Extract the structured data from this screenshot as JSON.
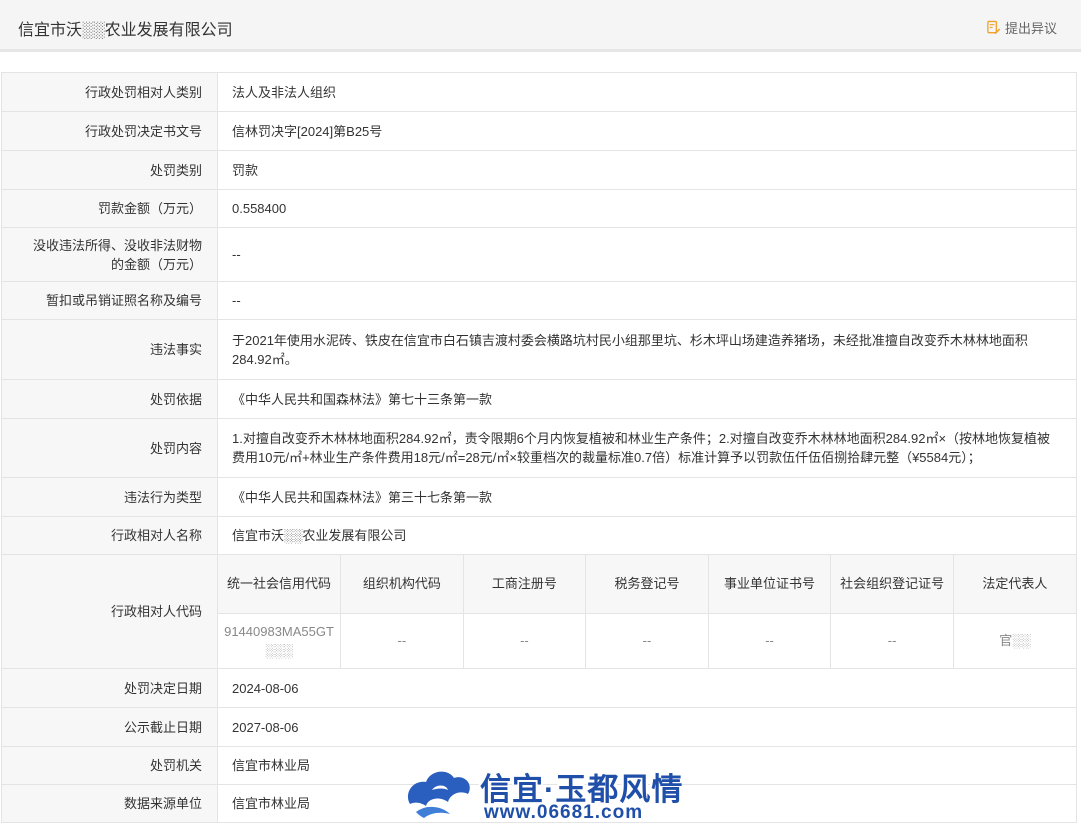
{
  "header": {
    "company_title": "信宜市沃░░农业发展有限公司",
    "objection_label": "提出异议",
    "objection_icon": "edit-document-icon",
    "accent_color": "#f0a22e"
  },
  "rows": {
    "party_type": {
      "label": "行政处罚相对人类别",
      "value": "法人及非法人组织"
    },
    "decision_no": {
      "label": "行政处罚决定书文号",
      "value": "信林罚决字[2024]第B25号"
    },
    "penalty_type": {
      "label": "处罚类别",
      "value": "罚款"
    },
    "fine_amount": {
      "label": "罚款金额（万元）",
      "value": "0.558400"
    },
    "confiscated": {
      "label": "没收违法所得、没收非法财物的金额（万元）",
      "value": "--"
    },
    "license": {
      "label": "暂扣或吊销证照名称及编号",
      "value": "--"
    },
    "facts": {
      "label": "违法事实",
      "value": "于2021年使用水泥砖、铁皮在信宜市白石镇吉渡村委会横路坑村民小组那里坑、杉木坪山场建造养猪场，未经批准擅自改变乔木林林地面积284.92㎡。"
    },
    "basis": {
      "label": "处罚依据",
      "value": "《中华人民共和国森林法》第七十三条第一款"
    },
    "content": {
      "label": "处罚内容",
      "value": "1.对擅自改变乔木林林地面积284.92㎡，责令限期6个月内恢复植被和林业生产条件；2.对擅自改变乔木林林地面积284.92㎡×（按林地恢复植被费用10元/㎡+林业生产条件费用18元/㎡=28元/㎡×较重档次的裁量标准0.7倍）标准计算予以罚款伍仟伍佰捌拾肆元整（¥5584元）；"
    },
    "violation_type": {
      "label": "违法行为类型",
      "value": "《中华人民共和国森林法》第三十七条第一款"
    },
    "party_name": {
      "label": "行政相对人名称",
      "value": "信宜市沃░░农业发展有限公司"
    },
    "party_code": {
      "label": "行政相对人代码"
    },
    "decision_date": {
      "label": "处罚决定日期",
      "value": "2024-08-06"
    },
    "publish_end": {
      "label": "公示截止日期",
      "value": "2027-08-06"
    },
    "authority": {
      "label": "处罚机关",
      "value": "信宜市林业局"
    },
    "source": {
      "label": "数据来源单位",
      "value": "信宜市林业局"
    }
  },
  "codes": {
    "headers": [
      "统一社会信用代码",
      "组织机构代码",
      "工商注册号",
      "税务登记号",
      "事业单位证书号",
      "社会组织登记证号",
      "法定代表人"
    ],
    "values": {
      "credit_code": "91440983MA55GT░░░",
      "org_code": "--",
      "biz_reg": "--",
      "tax_reg": "--",
      "institution": "--",
      "social_org": "--",
      "legal_rep": "官░░"
    }
  },
  "watermark": {
    "title": "信宜·玉都风情",
    "url": "www.06681.com",
    "icon": "cloud-logo-icon"
  }
}
